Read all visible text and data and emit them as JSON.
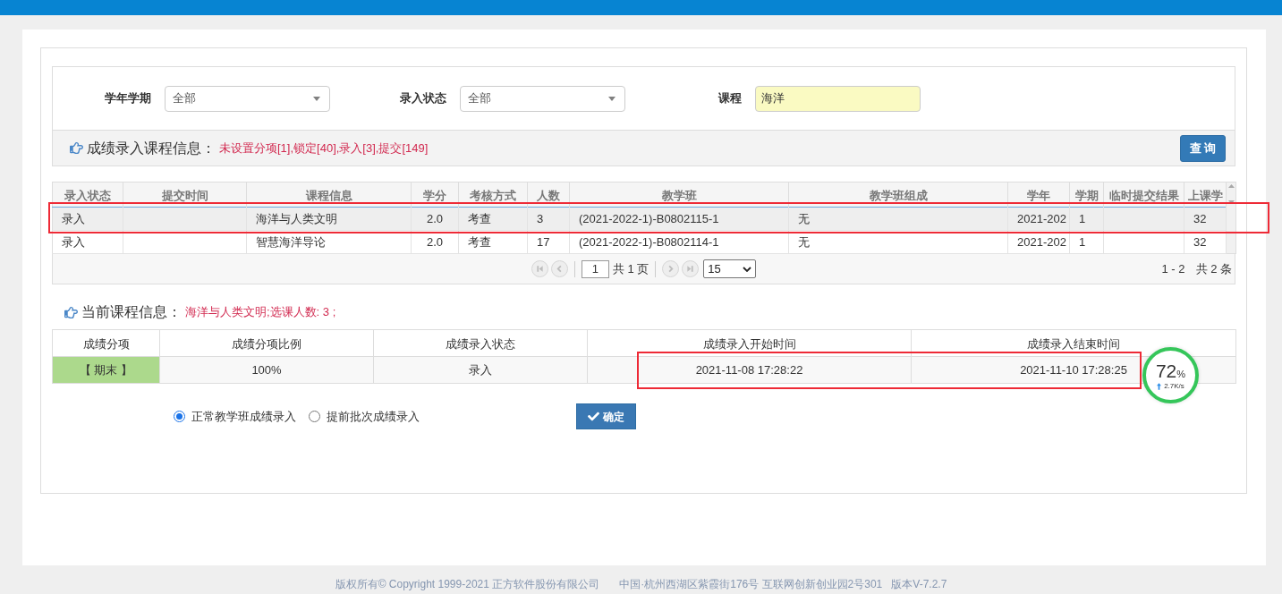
{
  "filters": [
    {
      "label": "学年学期",
      "kind": "select",
      "value": "全部"
    },
    {
      "label": "录入状态",
      "kind": "select",
      "value": "全部"
    },
    {
      "label": "课程",
      "kind": "text",
      "value": "海洋"
    }
  ],
  "course_info": {
    "title": "成绩录入课程信息：",
    "summary": "未设置分项[1],锁定[40],录入[3],提交[149]",
    "button": "查 询"
  },
  "table": {
    "columns": [
      "录入状态",
      "提交时间",
      "课程信息",
      "学分",
      "考核方式",
      "人数",
      "教学班",
      "教学班组成",
      "学年",
      "学期",
      "临时提交结果",
      "上课学"
    ],
    "rows": [
      {
        "selected": true,
        "highlighted": true,
        "cells": [
          "录入",
          null,
          "海洋与人类文明",
          "2.0",
          "考查",
          "3",
          "(2021-2022-1)-B0802115-1",
          "无",
          "2021-202",
          "1",
          null,
          "32"
        ]
      },
      {
        "selected": false,
        "highlighted": false,
        "cells": [
          "录入",
          null,
          "智慧海洋导论",
          "2.0",
          "考查",
          "17",
          "(2021-2022-1)-B0802114-1",
          "无",
          "2021-202",
          "1",
          null,
          "32"
        ]
      }
    ]
  },
  "pager": {
    "page": "1",
    "total_pages": "共 1 页",
    "page_size": "15",
    "range": "1 - 2",
    "total": "共 2 条"
  },
  "current": {
    "title": "当前课程信息：",
    "summary": "海洋与人类文明;选课人数: 3 ;",
    "columns": [
      "成绩分项",
      "成绩分项比例",
      "成绩录入状态",
      "成绩录入开始时间",
      "成绩录入结束时间"
    ],
    "rows": [
      {
        "cells": [
          {
            "text": "【 期末 】",
            "kind": "tag",
            "highlighted": false
          },
          {
            "text": "100%",
            "kind": "plain",
            "highlighted": false
          },
          {
            "text": "录入",
            "kind": "plain",
            "highlighted": false
          },
          {
            "text": "2021-11-08 17:28:22",
            "kind": "plain",
            "highlighted": true
          },
          {
            "text": "2021-11-10 17:28:25",
            "kind": "plain",
            "highlighted": true
          }
        ]
      }
    ]
  },
  "entry_modes": [
    {
      "label": "正常教学班成绩录入",
      "selected": true
    },
    {
      "label": "提前批次成绩录入",
      "selected": false
    }
  ],
  "confirm_button": "确定",
  "speed_widget": {
    "percent": "72",
    "unit": "%",
    "speed": "2.7K/s"
  },
  "footer": [
    "版权所有© Copyright 1999-2021 正方软件股份有限公司",
    "中国·杭州西湖区紫霞街176号 互联网创新创业园2号301",
    "版本V-7.2.7"
  ]
}
